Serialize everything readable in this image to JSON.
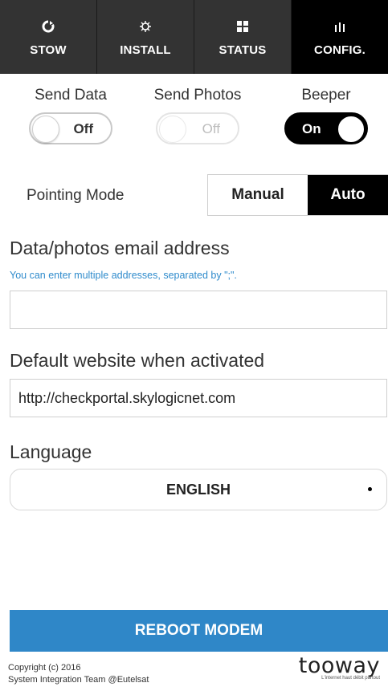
{
  "tabs": [
    {
      "label": "STOW",
      "icon": "stow-icon",
      "active": false
    },
    {
      "label": "INSTALL",
      "icon": "install-icon",
      "active": false
    },
    {
      "label": "STATUS",
      "icon": "status-icon",
      "active": false
    },
    {
      "label": "CONFIG.",
      "icon": "config-icon",
      "active": true
    }
  ],
  "toggles": {
    "send_data": {
      "label": "Send Data",
      "state": "Off"
    },
    "send_photos": {
      "label": "Send Photos",
      "state": "Off"
    },
    "beeper": {
      "label": "Beeper",
      "state": "On"
    }
  },
  "pointing": {
    "label": "Pointing Mode",
    "options": [
      "Manual",
      "Auto"
    ],
    "selected": "Auto"
  },
  "email": {
    "heading": "Data/photos email address",
    "hint": "You can enter multiple addresses, separated by \";\".",
    "value": ""
  },
  "website": {
    "heading": "Default website when activated",
    "value": "http://checkportal.skylogicnet.com"
  },
  "language": {
    "heading": "Language",
    "value": "ENGLISH"
  },
  "reboot_label": "REBOOT MODEM",
  "footer": {
    "line1": "Copyright (c) 2016",
    "line2": "System Integration Team @Eutelsat"
  },
  "brand": {
    "name": "tooway",
    "tagline": "L'internet haut débit partout"
  },
  "colors": {
    "accent": "#2f87c8",
    "hint": "#2f8bcc",
    "tabbar": "#333333",
    "active_tab": "#000000"
  }
}
